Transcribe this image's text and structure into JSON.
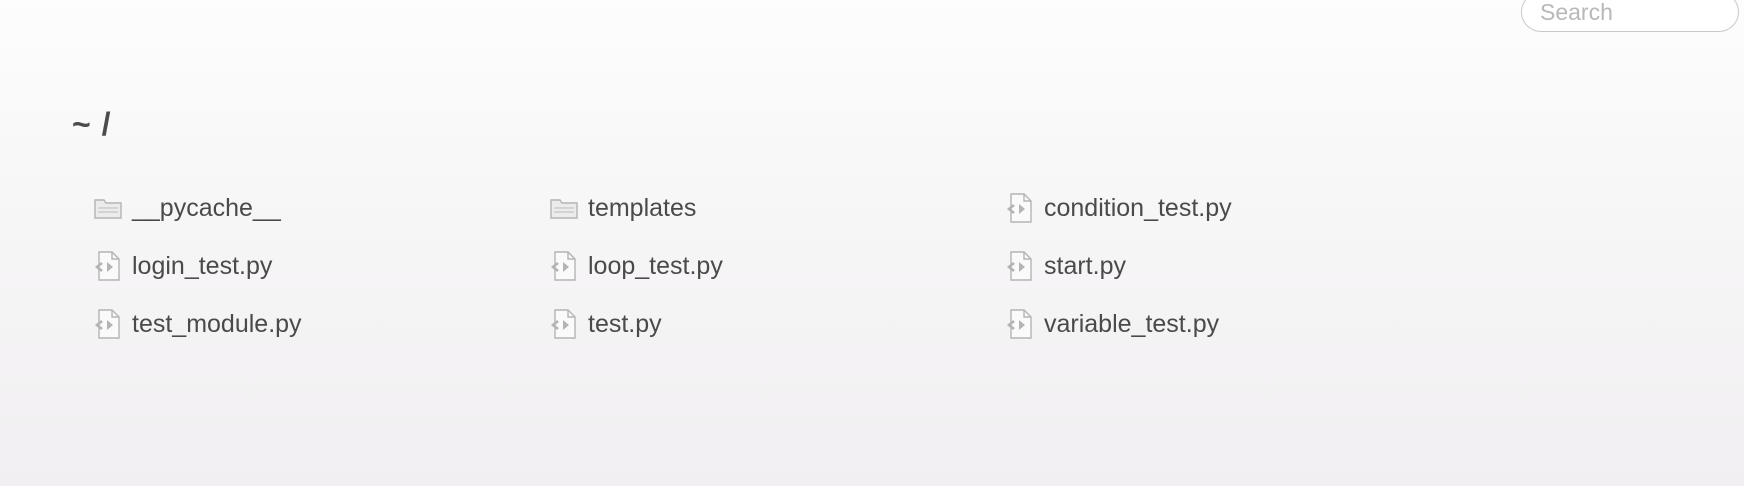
{
  "search": {
    "placeholder": "Search"
  },
  "breadcrumb": {
    "path": "~ /"
  },
  "files": [
    {
      "name": "__pycache__",
      "type": "folder",
      "icon": "folder-icon"
    },
    {
      "name": "templates",
      "type": "folder",
      "icon": "folder-icon"
    },
    {
      "name": "condition_test.py",
      "type": "file",
      "icon": "python-file-icon"
    },
    {
      "name": "login_test.py",
      "type": "file",
      "icon": "python-file-icon"
    },
    {
      "name": "loop_test.py",
      "type": "file",
      "icon": "python-file-icon"
    },
    {
      "name": "start.py",
      "type": "file",
      "icon": "python-file-icon"
    },
    {
      "name": "test_module.py",
      "type": "file",
      "icon": "python-file-icon"
    },
    {
      "name": "test.py",
      "type": "file",
      "icon": "python-file-icon"
    },
    {
      "name": "variable_test.py",
      "type": "file",
      "icon": "python-file-icon"
    }
  ],
  "colors": {
    "text": "#4a4a4a",
    "icon": "#b4b4b4",
    "search_border": "#c8c8c8"
  }
}
